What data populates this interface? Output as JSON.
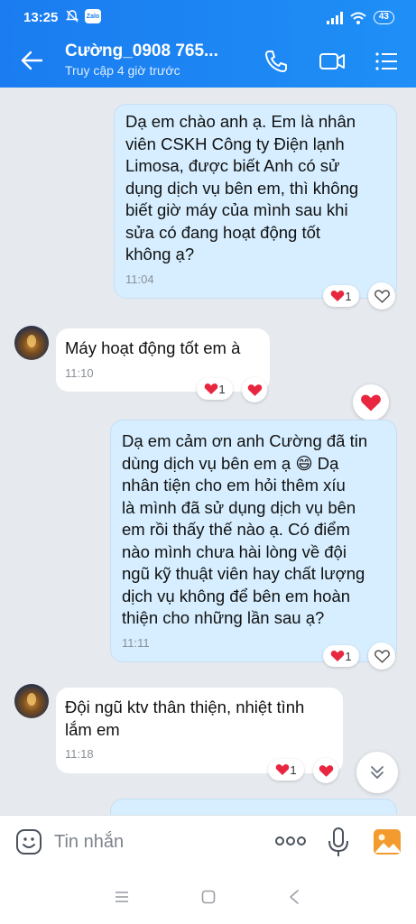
{
  "status_bar": {
    "time": "13:25",
    "app_badge": "Zalo",
    "battery": "43"
  },
  "header": {
    "title": "Cường_0908 765...",
    "subtitle": "Truy cập 4 giờ trước"
  },
  "messages": [
    {
      "direction": "sent",
      "text": "Dạ em chào anh ạ. Em là nhân\nviên CSKH Công ty Điện lạnh\nLimosa, được biết Anh có sử\ndụng dịch vụ bên em, thì không\nbiết giờ máy của mình sau khi\nsửa có đang hoạt động tốt\nkhông ạ?",
      "time": "11:04",
      "reaction_count": "1"
    },
    {
      "direction": "received",
      "text": "Máy hoạt động tốt em à",
      "time": "11:10",
      "reaction_count": "1"
    },
    {
      "direction": "sent",
      "text": "Dạ em cảm ơn anh Cường đã tin\ndùng dịch vụ bên em ạ 😄  Dạ\nnhân tiện cho em hỏi thêm xíu\nlà mình đã sử dụng dịch vụ bên\nem rồi thấy thế nào ạ. Có điểm\nnào mình chưa hài lòng về đội\nngũ kỹ thuật viên hay chất lượng\ndịch vụ không để bên em hoàn\nthiện cho những lần sau ạ?",
      "time": "11:11",
      "reaction_count": "1"
    },
    {
      "direction": "received",
      "text": "Đội ngũ ktv thân thiện, nhiệt tình\nlắm em",
      "time": "11:18",
      "reaction_count": "1"
    }
  ],
  "composer": {
    "placeholder": "Tin nhắn"
  },
  "colors": {
    "header_blue": "#1a7cf0",
    "sent_bubble": "#d6eeff",
    "heart_red": "#e8263f"
  },
  "icons": [
    "back-arrow-icon",
    "phone-icon",
    "video-call-icon",
    "menu-list-icon",
    "sticker-icon",
    "more-icon",
    "microphone-icon",
    "image-icon",
    "chevron-double-down-icon"
  ]
}
